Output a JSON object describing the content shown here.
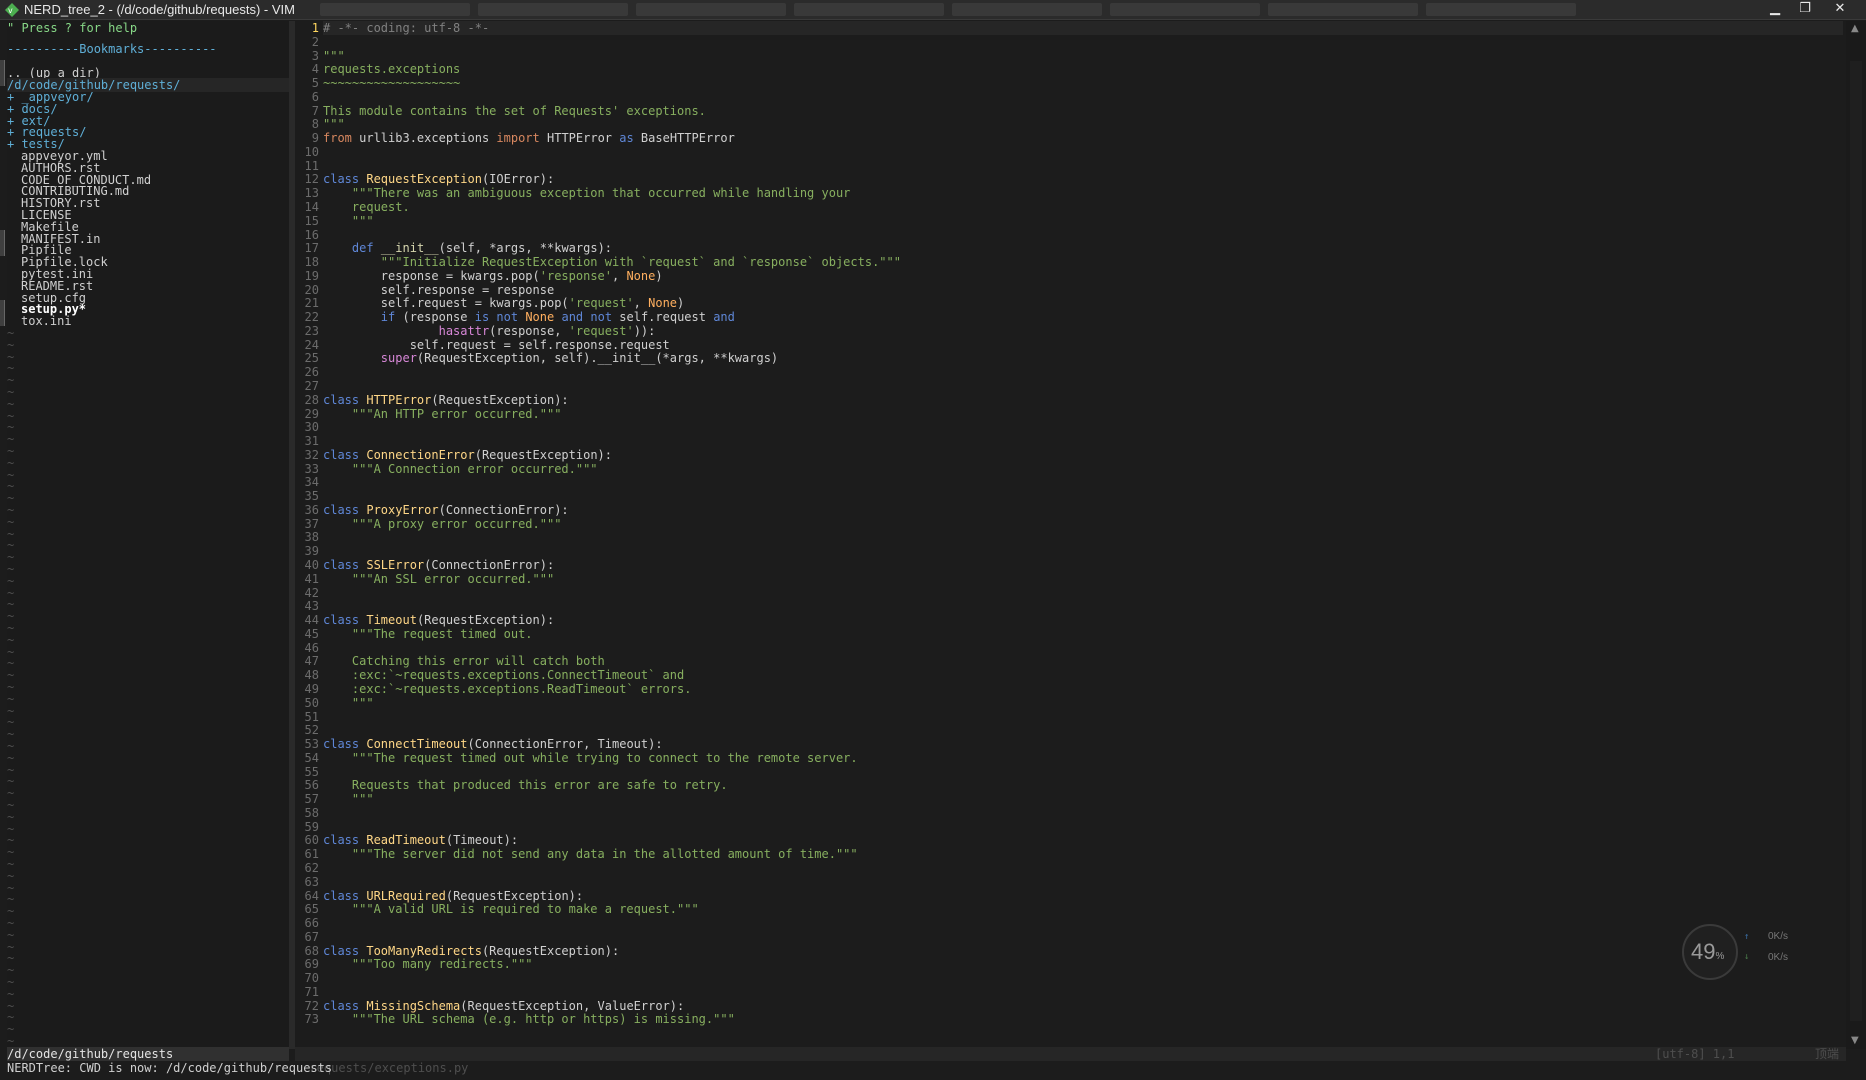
{
  "window": {
    "title": "NERD_tree_2 - (/d/code/github/requests) - VIM",
    "minimize_glyph": "▁",
    "maximize_glyph": "❐",
    "close_glyph": "✕"
  },
  "tree": {
    "help": "\" Press ? for help",
    "bookmarks": "----------Bookmarks----------",
    "up_dir": ".. (up a dir)",
    "cwd": "/d/code/github/requests/",
    "dirs": [
      "+ _appveyor/",
      "+ docs/",
      "+ ext/",
      "+ requests/",
      "+ tests/"
    ],
    "files": [
      "appveyor.yml",
      "AUTHORS.rst",
      "CODE_OF_CONDUCT.md",
      "CONTRIBUTING.md",
      "HISTORY.rst",
      "LICENSE",
      "Makefile",
      "MANIFEST.in",
      "Pipfile",
      "Pipfile.lock",
      "pytest.ini",
      "README.rst",
      "setup.cfg",
      "setup.py*",
      "tox.ini"
    ],
    "tilde": "~"
  },
  "editor": {
    "lines": [
      "# -*- coding: utf-8 -*-",
      "",
      "\"\"\"",
      "requests.exceptions",
      "~~~~~~~~~~~~~~~~~~~",
      "",
      "This module contains the set of Requests' exceptions.",
      "\"\"\"",
      "from urllib3.exceptions import HTTPError as BaseHTTPError",
      "",
      "",
      "class RequestException(IOError):",
      "    \"\"\"There was an ambiguous exception that occurred while handling your",
      "    request.",
      "    \"\"\"",
      "",
      "    def __init__(self, *args, **kwargs):",
      "        \"\"\"Initialize RequestException with `request` and `response` objects.\"\"\"",
      "        response = kwargs.pop('response', None)",
      "        self.response = response",
      "        self.request = kwargs.pop('request', None)",
      "        if (response is not None and not self.request and",
      "                hasattr(response, 'request')):",
      "            self.request = self.response.request",
      "        super(RequestException, self).__init__(*args, **kwargs)",
      "",
      "",
      "class HTTPError(RequestException):",
      "    \"\"\"An HTTP error occurred.\"\"\"",
      "",
      "",
      "class ConnectionError(RequestException):",
      "    \"\"\"A Connection error occurred.\"\"\"",
      "",
      "",
      "class ProxyError(ConnectionError):",
      "    \"\"\"A proxy error occurred.\"\"\"",
      "",
      "",
      "class SSLError(ConnectionError):",
      "    \"\"\"An SSL error occurred.\"\"\"",
      "",
      "",
      "class Timeout(RequestException):",
      "    \"\"\"The request timed out.",
      "",
      "    Catching this error will catch both",
      "    :exc:`~requests.exceptions.ConnectTimeout` and",
      "    :exc:`~requests.exceptions.ReadTimeout` errors.",
      "    \"\"\"",
      "",
      "",
      "class ConnectTimeout(ConnectionError, Timeout):",
      "    \"\"\"The request timed out while trying to connect to the remote server.",
      "",
      "    Requests that produced this error are safe to retry.",
      "    \"\"\"",
      "",
      "",
      "class ReadTimeout(Timeout):",
      "    \"\"\"The server did not send any data in the allotted amount of time.\"\"\"",
      "",
      "",
      "class URLRequired(RequestException):",
      "    \"\"\"A valid URL is required to make a request.\"\"\"",
      "",
      "",
      "class TooManyRedirects(RequestException):",
      "    \"\"\"Too many redirects.\"\"\"",
      "",
      "",
      "class MissingSchema(RequestException, ValueError):",
      "    \"\"\"The URL schema (e.g. http or https) is missing.\"\"\""
    ]
  },
  "status": {
    "left": "/d/code/github/requests",
    "right_file": "requests/exceptions.py",
    "right_enc": "[utf-8] 1,1",
    "right_pct": "顶端",
    "cmdline": "NERDTree: CWD is now: /d/code/github/requests"
  },
  "widget": {
    "percent": "49",
    "percent_sign": "%",
    "up_speed": "0K/s",
    "down_speed": "0K/s",
    "up_glyph": "↑",
    "down_glyph": "↓"
  }
}
